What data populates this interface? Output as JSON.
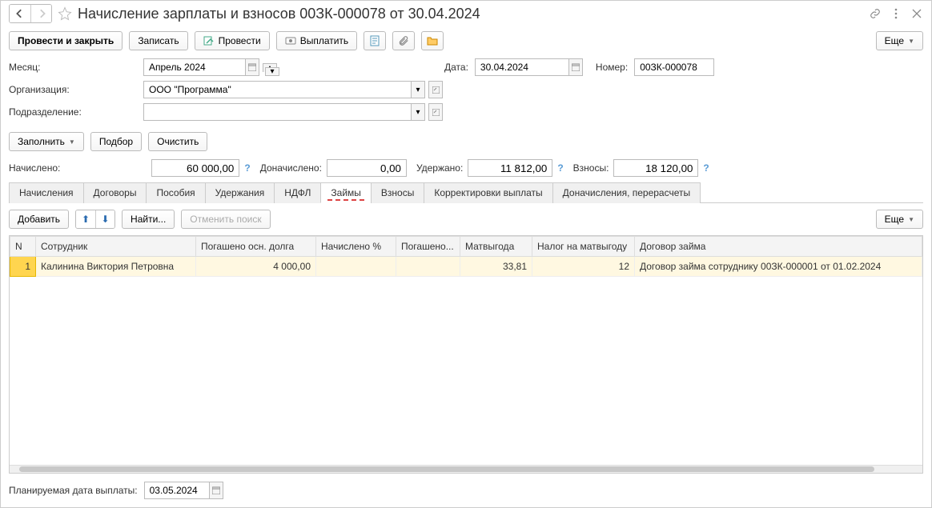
{
  "title": "Начисление зарплаты и взносов 00ЗК-000078 от 30.04.2024",
  "toolbar": {
    "post_close": "Провести и закрыть",
    "save": "Записать",
    "post": "Провести",
    "pay": "Выплатить",
    "more": "Еще"
  },
  "form": {
    "month_label": "Месяц:",
    "month_value": "Апрель 2024",
    "date_label": "Дата:",
    "date_value": "30.04.2024",
    "number_label": "Номер:",
    "number_value": "00ЗК-000078",
    "org_label": "Организация:",
    "org_value": "ООО \"Программа\"",
    "dept_label": "Подразделение:",
    "dept_value": ""
  },
  "actions": {
    "fill": "Заполнить",
    "pick": "Подбор",
    "clear": "Очистить"
  },
  "totals": {
    "accrued_label": "Начислено:",
    "accrued_value": "60 000,00",
    "addl_label": "Доначислено:",
    "addl_value": "0,00",
    "withheld_label": "Удержано:",
    "withheld_value": "11 812,00",
    "contrib_label": "Взносы:",
    "contrib_value": "18 120,00"
  },
  "tabs": [
    "Начисления",
    "Договоры",
    "Пособия",
    "Удержания",
    "НДФЛ",
    "Займы",
    "Взносы",
    "Корректировки выплаты",
    "Доначисления, перерасчеты"
  ],
  "active_tab": 5,
  "subtoolbar": {
    "add": "Добавить",
    "find": "Найти...",
    "cancel_find": "Отменить поиск",
    "more": "Еще"
  },
  "table": {
    "columns": [
      "N",
      "Сотрудник",
      "Погашено осн. долга",
      "Начислено %",
      "Погашено...",
      "Матвыгода",
      "Налог на матвыгоду",
      "Договор займа"
    ],
    "rows": [
      {
        "n": "1",
        "employee": "Калинина Виктория Петровна",
        "repaid": "4 000,00",
        "interest": "",
        "repaid2": "",
        "matbenefit": "33,81",
        "tax": "12",
        "contract": "Договор займа сотруднику 00ЗК-000001 от 01.02.2024"
      }
    ]
  },
  "footer": {
    "plan_date_label": "Планируемая дата выплаты:",
    "plan_date_value": "03.05.2024"
  }
}
